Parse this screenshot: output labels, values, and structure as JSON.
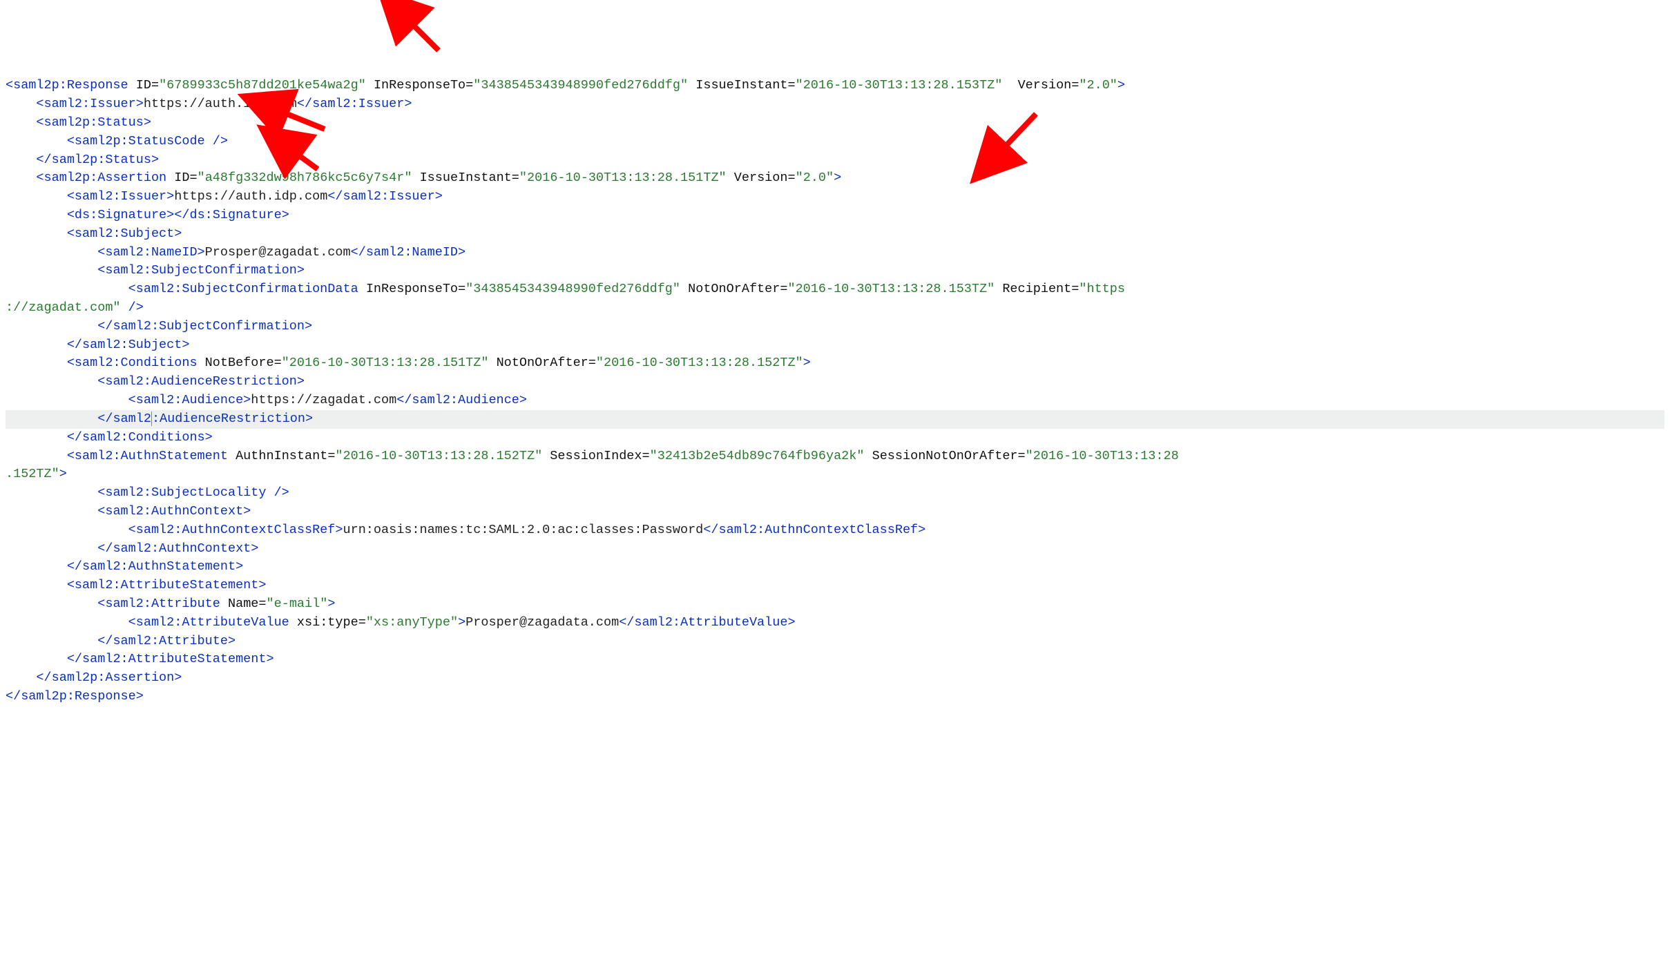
{
  "response": {
    "tagOpen": "<saml2p:Response",
    "tagClose": "</saml2p:Response>",
    "idLabel": "ID",
    "idValue": "\"6789933c5h87dd201ke54wa2g\"",
    "inResponseToLabel": "InResponseTo",
    "inResponseToValue": "\"3438545343948990fed276ddfg\"",
    "issueInstantLabel": "IssueInstant",
    "issueInstantValue": "\"2016-10-30T13:13:28.153TZ\"",
    "versionLabel": "Version",
    "versionValue": "\"2.0\"",
    "gt": ">"
  },
  "issuerOuter": {
    "open": "<saml2:Issuer>",
    "value": "https://auth.idp.com",
    "close": "</saml2:Issuer>"
  },
  "status": {
    "open": "<saml2p:Status>",
    "codeSelf": "<saml2p:StatusCode />",
    "close": "</saml2p:Status>"
  },
  "assertion": {
    "tagOpen": "<saml2p:Assertion",
    "tagClose": "</saml2p:Assertion>",
    "idLabel": "ID",
    "idValue": "\"a48fg332dw98h786kc5c6y7s4r\"",
    "issueInstantLabel": "IssueInstant",
    "issueInstantValue": "\"2016-10-30T13:13:28.151TZ\"",
    "versionLabel": "Version",
    "versionValue": "\"2.0\"",
    "gt": ">"
  },
  "issuerInner": {
    "open": "<saml2:Issuer>",
    "value": "https://auth.idp.com",
    "close": "</saml2:Issuer>"
  },
  "signature": {
    "open": "<ds:Signature>",
    "close": "</ds:Signature>"
  },
  "subject": {
    "open": "<saml2:Subject>",
    "close": "</saml2:Subject>"
  },
  "nameId": {
    "open": "<saml2:NameID>",
    "value": "Prosper@zagadat.com",
    "close": "</saml2:NameID>"
  },
  "subjectConfirmation": {
    "open": "<saml2:SubjectConfirmation>",
    "close": "</saml2:SubjectConfirmation>"
  },
  "subjectConfirmationData": {
    "tagOpen": "<saml2:SubjectConfirmationData",
    "inResponseToLabel": "InResponseTo",
    "inResponseToValue": "\"3438545343948990fed276ddfg\"",
    "notOnOrAfterLabel": "NotOnOrAfter",
    "notOnOrAfterValue": "\"2016-10-30T13:13:28.153TZ\"",
    "recipientLabel": "Recipient",
    "recipientValuePart1": "\"https",
    "recipientValuePart2": "://zagadat.com\"",
    "selfClose": " />"
  },
  "conditions": {
    "tagOpen": "<saml2:Conditions",
    "notBeforeLabel": "NotBefore",
    "notBeforeValue": "\"2016-10-30T13:13:28.151TZ\"",
    "notOnOrAfterLabel": "NotOnOrAfter",
    "notOnOrAfterValue": "\"2016-10-30T13:13:28.152TZ\"",
    "gt": ">",
    "close": "</saml2:Conditions>"
  },
  "audienceRestriction": {
    "open": "<saml2:AudienceRestriction>",
    "closePart1": "</saml2",
    "closePart2": ":AudienceRestriction>"
  },
  "audience": {
    "open": "<saml2:Audience>",
    "value": "https://zagadat.com",
    "close": "</saml2:Audience>"
  },
  "authnStatement": {
    "tagOpen": "<saml2:AuthnStatement",
    "authnInstantLabel": "AuthnInstant",
    "authnInstantValue": "\"2016-10-30T13:13:28.152TZ\"",
    "sessionIndexLabel": "SessionIndex",
    "sessionIndexValue": "\"32413b2e54db89c764fb96ya2k\"",
    "sessionNotOnOrAfterLabel": "SessionNotOnOrAfter",
    "sessionNotOnOrAfterValuePart1": "\"2016-10-30T13:13:28",
    "sessionNotOnOrAfterValuePart2": ".152TZ\"",
    "gt": ">",
    "close": "</saml2:AuthnStatement>"
  },
  "subjectLocality": {
    "self": "<saml2:SubjectLocality />"
  },
  "authnContext": {
    "open": "<saml2:AuthnContext>",
    "close": "</saml2:AuthnContext>"
  },
  "authnContextClassRef": {
    "open": "<saml2:AuthnContextClassRef>",
    "value": "urn:oasis:names:tc:SAML:2.0:ac:classes:Password",
    "close": "</saml2:AuthnContextClassRef>"
  },
  "attributeStatement": {
    "open": "<saml2:AttributeStatement>",
    "close": "</saml2:AttributeStatement>"
  },
  "attribute": {
    "tagOpen": "<saml2:Attribute",
    "nameLabel": "Name",
    "nameValue": "\"e-mail\"",
    "gt": ">",
    "close": "</saml2:Attribute>"
  },
  "attributeValue": {
    "tagOpen": "<saml2:AttributeValue",
    "xsiTypeLabel": "xsi:type",
    "xsiTypeValue": "\"xs:anyType\"",
    "gt": ">",
    "value": "Prosper@zagadata.com",
    "close": "</saml2:AttributeValue>"
  }
}
